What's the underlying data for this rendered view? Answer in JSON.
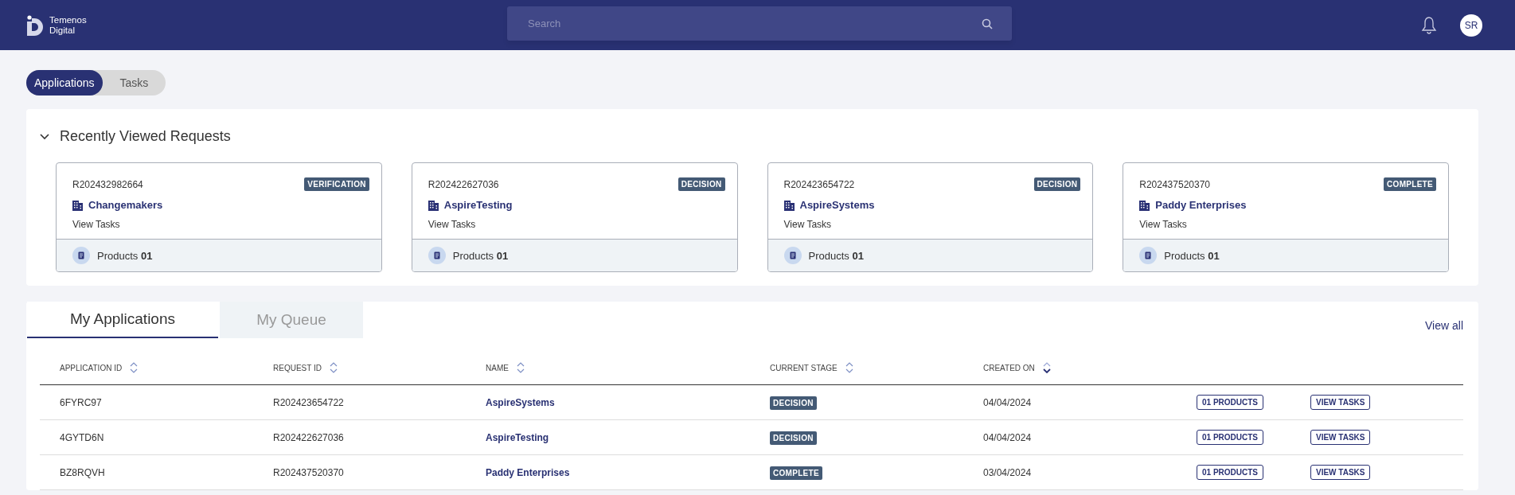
{
  "header": {
    "logo_line1": "Temenos",
    "logo_line2": "Digital",
    "search": {
      "placeholder": "Search"
    },
    "avatar": "SR"
  },
  "toggle": [
    {
      "label": "Applications",
      "selected": true
    },
    {
      "label": "Tasks",
      "selected": false
    }
  ],
  "recent": {
    "title": "Recently Viewed Requests",
    "expanded": true,
    "cards": [
      {
        "request_id": "R202432982664",
        "stage": "VERIFICATION",
        "name": "Changemakers",
        "link": "View Tasks",
        "products_label": "Products",
        "products_count": "01"
      },
      {
        "request_id": "R202422627036",
        "stage": "DECISION",
        "name": "AspireTesting",
        "link": "View Tasks",
        "products_label": "Products",
        "products_count": "01"
      },
      {
        "request_id": "R202423654722",
        "stage": "DECISION",
        "name": "AspireSystems",
        "link": "View Tasks",
        "products_label": "Products",
        "products_count": "01"
      },
      {
        "request_id": "R202437520370",
        "stage": "COMPLETE",
        "name": "Paddy Enterprises",
        "link": "View Tasks",
        "products_label": "Products",
        "products_count": "01"
      }
    ]
  },
  "applications": {
    "tabs": [
      {
        "label": "My Applications",
        "selected": true
      },
      {
        "label": "My Queue",
        "selected": false
      }
    ],
    "view_all": "View all",
    "columns": [
      {
        "label": "APPLICATION ID",
        "sorted": false
      },
      {
        "label": "REQUEST ID",
        "sorted": false
      },
      {
        "label": "NAME",
        "sorted": false
      },
      {
        "label": "CURRENT STAGE",
        "sorted": false
      },
      {
        "label": "CREATED ON",
        "sorted": true
      }
    ],
    "rows": [
      {
        "application_id": "6FYRC97",
        "request_id": "R202423654722",
        "name": "AspireSystems",
        "stage": "DECISION",
        "created_on": "04/04/2024",
        "products": "01 PRODUCTS",
        "tasks": "VIEW TASKS"
      },
      {
        "application_id": "4GYTD6N",
        "request_id": "R202422627036",
        "name": "AspireTesting",
        "stage": "DECISION",
        "created_on": "04/04/2024",
        "products": "01 PRODUCTS",
        "tasks": "VIEW TASKS"
      },
      {
        "application_id": "BZ8RQVH",
        "request_id": "R202437520370",
        "name": "Paddy Enterprises",
        "stage": "COMPLETE",
        "created_on": "03/04/2024",
        "products": "01 PRODUCTS",
        "tasks": "VIEW TASKS"
      }
    ]
  }
}
